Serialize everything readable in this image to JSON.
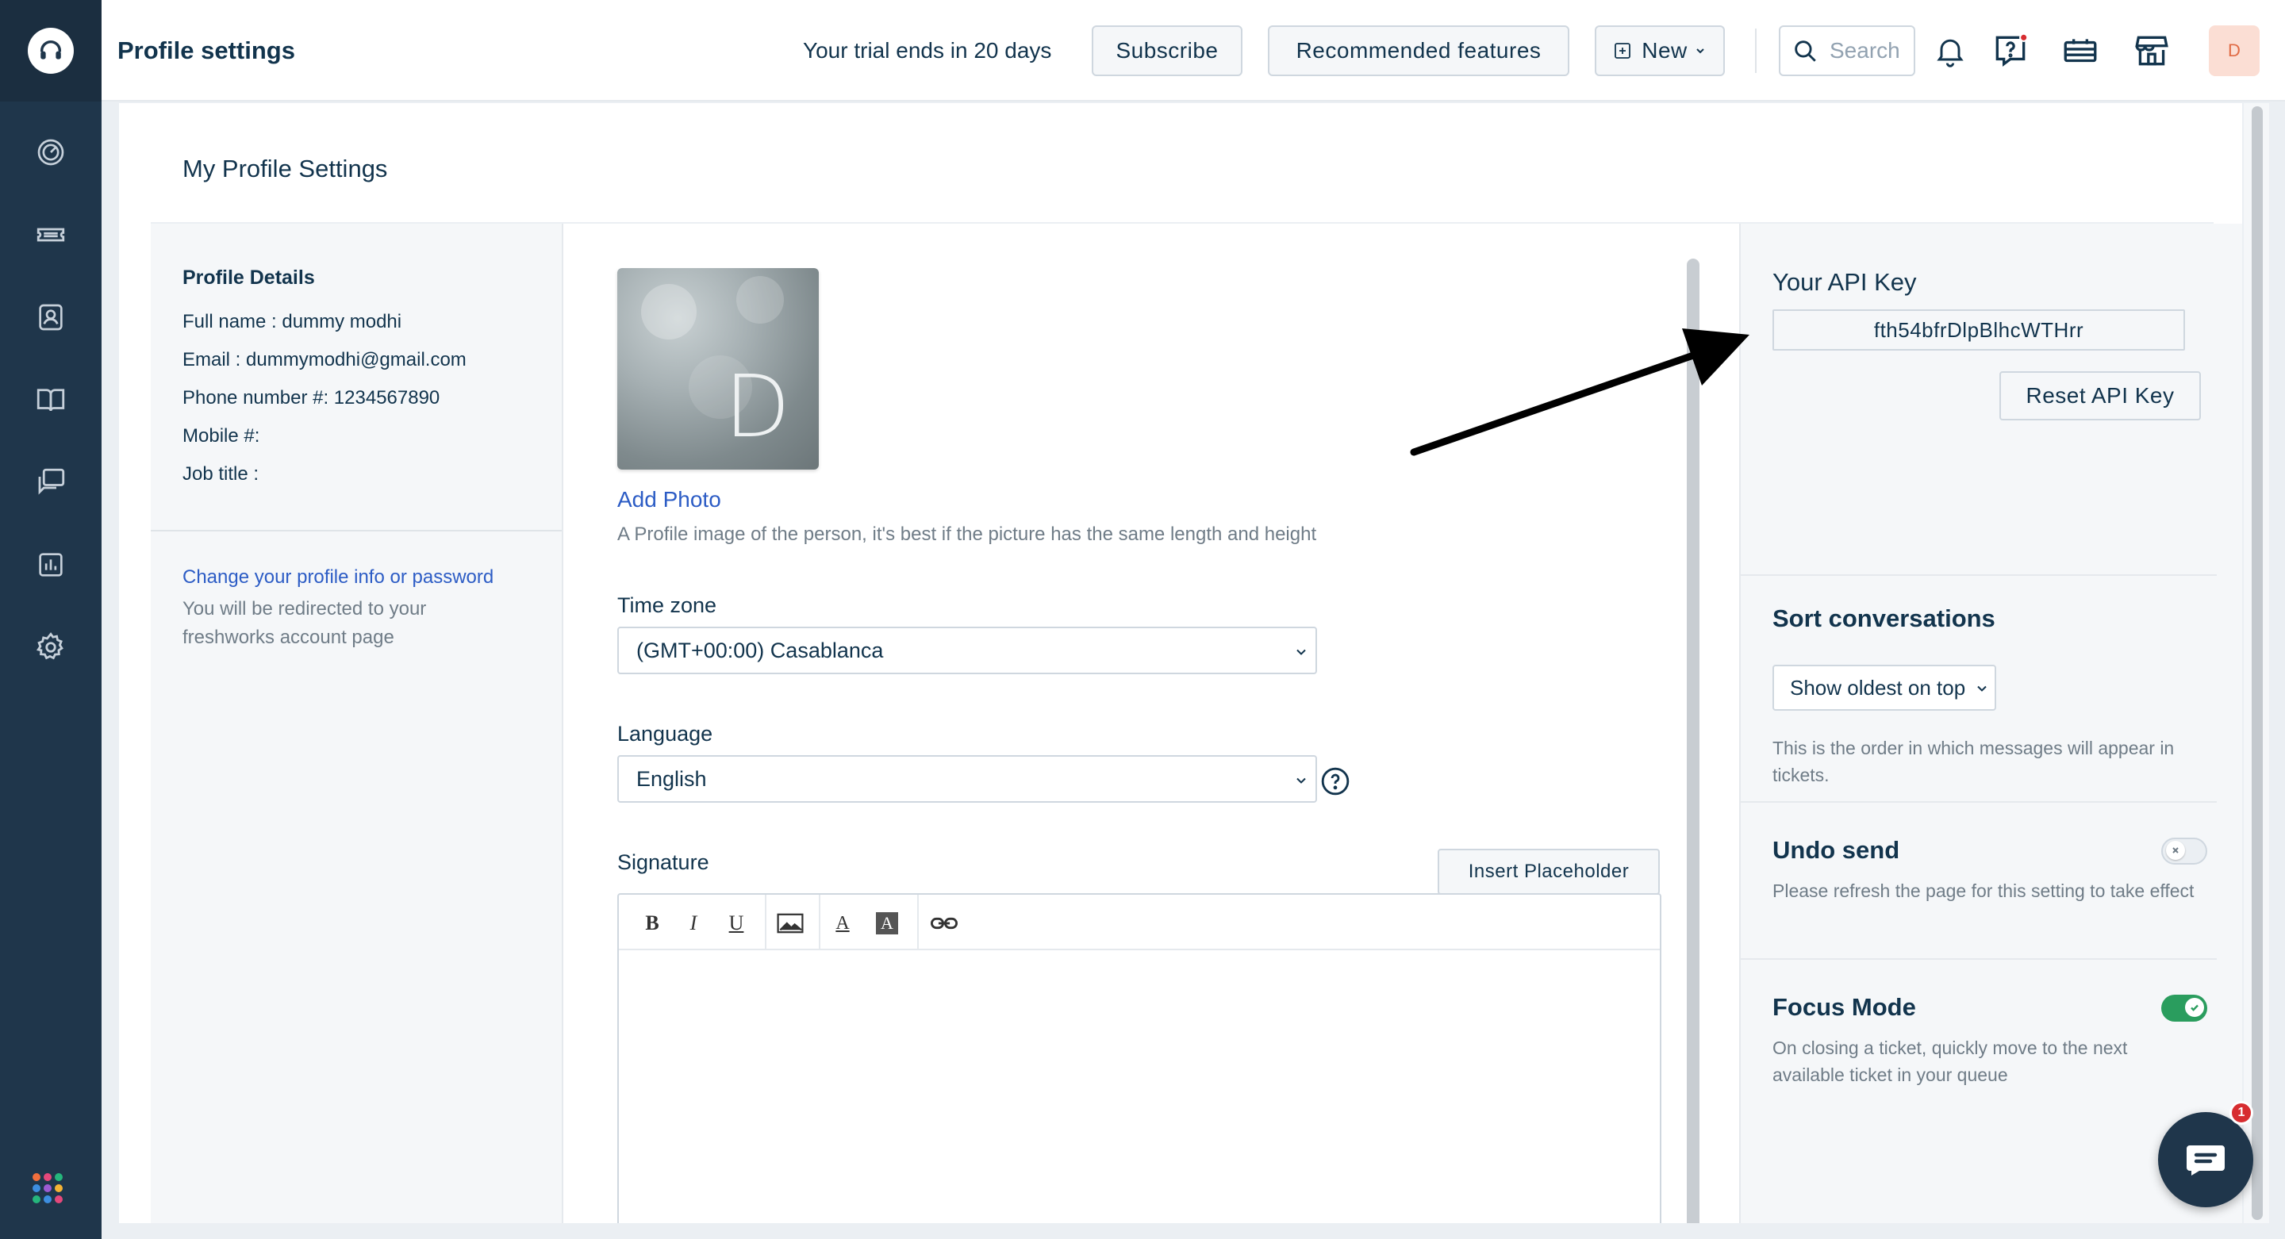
{
  "header": {
    "title": "Profile settings",
    "trial_text": "Your trial ends in 20 days",
    "subscribe_label": "Subscribe",
    "recommended_label": "Recommended features",
    "new_label": "New",
    "search_placeholder": "Search",
    "avatar_initial": "D"
  },
  "nav": {
    "items": [
      "dashboard",
      "tickets",
      "contacts",
      "solutions",
      "forums",
      "reports",
      "admin"
    ]
  },
  "content": {
    "title": "My Profile Settings"
  },
  "profile": {
    "section_title": "Profile Details",
    "full_name_label": "Full name : ",
    "full_name": "dummy modhi",
    "email_label": "Email : ",
    "email": "dummymodhi@gmail.com",
    "phone_label": "Phone number #: ",
    "phone": "1234567890",
    "mobile_label": "Mobile #:",
    "job_title_label": "Job title :",
    "change_link": "Change your profile info or password",
    "change_help": "You will be redirected to your freshworks account page"
  },
  "form": {
    "photo_initial": "D",
    "add_photo": "Add Photo",
    "photo_help": "A Profile image of the person, it's best if the picture has the same length and height",
    "timezone_label": "Time zone",
    "timezone_value": "(GMT+00:00) Casablanca",
    "language_label": "Language",
    "language_value": "English",
    "signature_label": "Signature",
    "insert_placeholder": "Insert Placeholder",
    "toolbar": {
      "bold": "B",
      "italic": "I",
      "underline": "U",
      "font_color": "A",
      "bg_color": "A"
    }
  },
  "api": {
    "title": "Your API Key",
    "key": "fth54bfrDlpBlhcWTHrr",
    "reset_label": "Reset API Key"
  },
  "sort": {
    "title": "Sort conversations",
    "value": "Show oldest on top",
    "help": "This is the order in which messages will appear in tickets."
  },
  "undo": {
    "title": "Undo send",
    "help": "Please refresh the page for this setting to take effect",
    "enabled": false
  },
  "focus": {
    "title": "Focus Mode",
    "help": "On closing a ticket, quickly move to the next available ticket in your queue",
    "enabled": true
  },
  "chat": {
    "badge": "1"
  },
  "colors": {
    "sidebar": "#1f364b",
    "link": "#2c5cc5",
    "toggle_on": "#2a9d5e",
    "badge": "#d72d30"
  }
}
